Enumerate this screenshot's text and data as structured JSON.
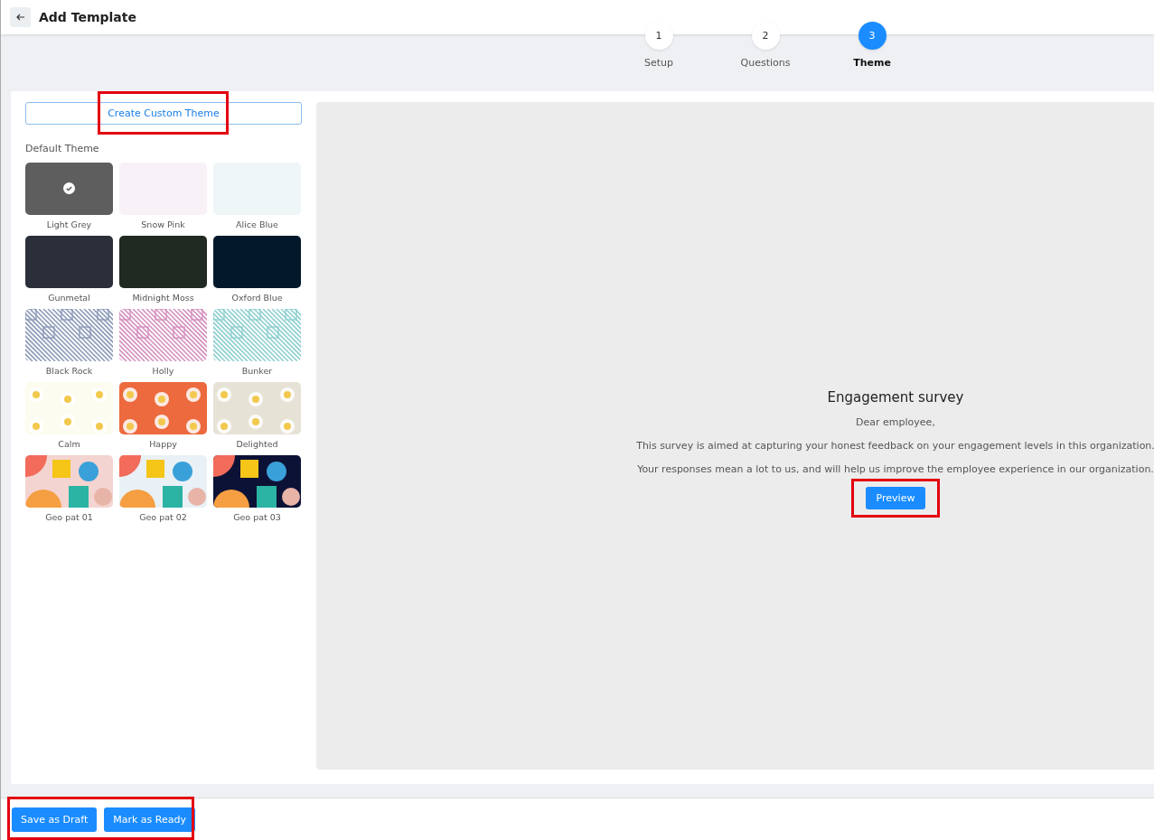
{
  "header": {
    "title": "Add Template"
  },
  "steps": [
    {
      "number": "1",
      "label": "Setup",
      "selected": false
    },
    {
      "number": "2",
      "label": "Questions",
      "selected": false
    },
    {
      "number": "3",
      "label": "Theme",
      "selected": true
    }
  ],
  "create_button": {
    "label": "Create Custom Theme",
    "highlighted": true
  },
  "themes_heading": "Default Theme",
  "themes": [
    {
      "name": "Light Grey",
      "kind": "solid",
      "color": "#5e5e5e",
      "selected": true
    },
    {
      "name": "Snow Pink",
      "kind": "solid",
      "color": "#f8f1f7",
      "selected": false
    },
    {
      "name": "Alice Blue",
      "kind": "solid",
      "color": "#eef6f8",
      "selected": false
    },
    {
      "name": "Gunmetal",
      "kind": "solid",
      "color": "#2b2f3a",
      "selected": false
    },
    {
      "name": "Midnight Moss",
      "kind": "solid",
      "color": "#202a23",
      "selected": false
    },
    {
      "name": "Oxford Blue",
      "kind": "solid",
      "color": "#02182b",
      "selected": false
    },
    {
      "name": "Black Rock",
      "kind": "lines",
      "color": "#8c9ab8",
      "selected": false
    },
    {
      "name": "Holly",
      "kind": "lines",
      "color": "#d490bf",
      "selected": false
    },
    {
      "name": "Bunker",
      "kind": "lines",
      "color": "#8fcfcf",
      "selected": false
    },
    {
      "name": "Calm",
      "kind": "floral",
      "color": "#fdfcf0",
      "selected": false
    },
    {
      "name": "Happy",
      "kind": "floral",
      "color": "#ec6a3e",
      "selected": false
    },
    {
      "name": "Delighted",
      "kind": "floral",
      "color": "#e6e2d6",
      "selected": false
    },
    {
      "name": "Geo pat 01",
      "kind": "geo",
      "color": "#f4d4d0",
      "selected": false
    },
    {
      "name": "Geo pat 02",
      "kind": "geo",
      "color": "#e9f1f6",
      "selected": false
    },
    {
      "name": "Geo pat 03",
      "kind": "geo",
      "color": "#0c1236",
      "selected": false
    }
  ],
  "preview": {
    "title": "Engagement survey",
    "greeting": "Dear employee,",
    "paragraphs": [
      "This survey is aimed at capturing your honest feedback on your engagement levels in this organization.",
      "Your responses mean a lot to us, and will help us improve the employee experience in our organization."
    ],
    "button": {
      "label": "Preview",
      "highlighted": true
    }
  },
  "footer": {
    "highlighted": true,
    "buttons": [
      "Save as Draft",
      "Mark as Ready"
    ]
  }
}
